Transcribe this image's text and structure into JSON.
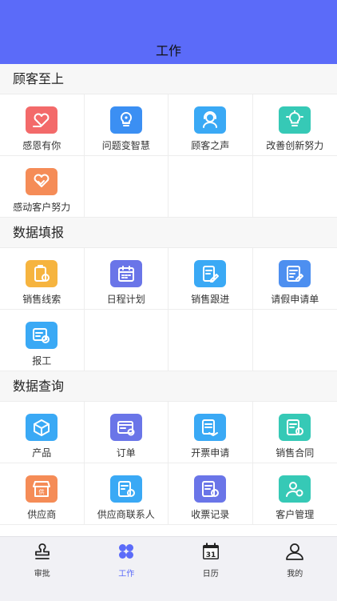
{
  "header": {
    "title": "工作"
  },
  "sections": [
    {
      "title": "顾客至上",
      "items": [
        {
          "label": "感恩有你",
          "icon": "heart-hand-icon",
          "color": "#f36a6a"
        },
        {
          "label": "问题变智慧",
          "icon": "lightbulb-gear-icon",
          "color": "#3b8ff3"
        },
        {
          "label": "顾客之声",
          "icon": "headset-icon",
          "color": "#3aa9f5"
        },
        {
          "label": "改善创新努力",
          "icon": "lightbulb-icon",
          "color": "#36c9b6"
        },
        {
          "label": "感动客户努力",
          "icon": "handshake-heart-icon",
          "color": "#f58c57"
        }
      ]
    },
    {
      "title": "数据填报",
      "items": [
        {
          "label": "销售线索",
          "icon": "clipboard-coin-icon",
          "color": "#f6b43f"
        },
        {
          "label": "日程计划",
          "icon": "calendar-icon",
          "color": "#6a75e8"
        },
        {
          "label": "销售跟进",
          "icon": "document-edit-icon",
          "color": "#3aa9f5"
        },
        {
          "label": "请假申请单",
          "icon": "form-edit-icon",
          "color": "#4d8ff0"
        },
        {
          "label": "报工",
          "icon": "report-clock-icon",
          "color": "#3aa9f5"
        }
      ]
    },
    {
      "title": "数据查询",
      "items": [
        {
          "label": "产品",
          "icon": "box-icon",
          "color": "#3aa9f5"
        },
        {
          "label": "订单",
          "icon": "order-icon",
          "color": "#6a75e8"
        },
        {
          "label": "开票申请",
          "icon": "invoice-stack-icon",
          "color": "#3aa9f5"
        },
        {
          "label": "销售合同",
          "icon": "contract-star-icon",
          "color": "#36c9b6"
        },
        {
          "label": "供应商",
          "icon": "store-icon",
          "color": "#f58c57"
        },
        {
          "label": "供应商联系人",
          "icon": "supplier-contact-icon",
          "color": "#3aa9f5"
        },
        {
          "label": "收票记录",
          "icon": "receipt-coin-icon",
          "color": "#6a75e8"
        },
        {
          "label": "客户管理",
          "icon": "customer-gear-icon",
          "color": "#36c9b6"
        }
      ]
    }
  ],
  "tabbar": [
    {
      "label": "审批",
      "icon": "stamp-icon",
      "active": false
    },
    {
      "label": "工作",
      "icon": "clover-icon",
      "active": true
    },
    {
      "label": "日历",
      "icon": "calendar-31-icon",
      "active": false,
      "day": "31"
    },
    {
      "label": "我的",
      "icon": "user-icon",
      "active": false
    }
  ],
  "colors": {
    "header": "#5b6bf9",
    "active_tab": "#5b6bf9"
  }
}
